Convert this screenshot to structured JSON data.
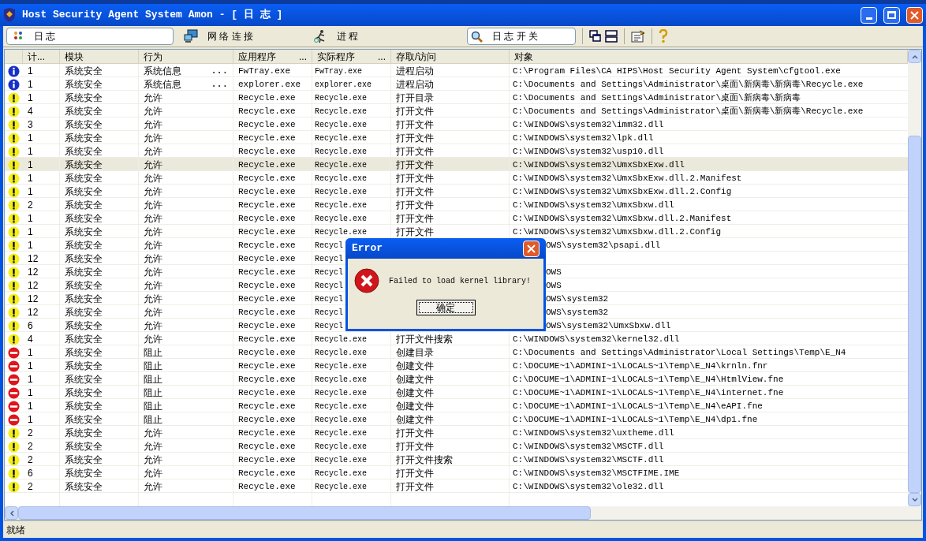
{
  "window": {
    "title": "Host Security Agent System Amon - [ 日 志 ]"
  },
  "toolbar": {
    "buttons": [
      {
        "label": "日 志",
        "kind": "log",
        "selected": true
      },
      {
        "label": "网 络 连 接",
        "kind": "network",
        "selected": false
      },
      {
        "label": "进 程",
        "kind": "process",
        "selected": false
      }
    ],
    "search": {
      "value": "日 志 开 关"
    }
  },
  "table": {
    "columns": [
      {
        "label": "计..."
      },
      {
        "label": "模块"
      },
      {
        "label": "行为"
      },
      {
        "label": "应用程序",
        "more": "..."
      },
      {
        "label": "实际程序",
        "more": "..."
      },
      {
        "label": "存取/访问"
      },
      {
        "label": "对象"
      }
    ],
    "rows": [
      {
        "kind": "info",
        "count": "1",
        "module": "系统安全",
        "action": "系统信息",
        "action_more": "...",
        "app": "FwTray.exe",
        "actual": "FwTray.exe",
        "access": "进程启动",
        "object": "C:\\Program Files\\CA HIPS\\Host Security Agent System\\cfgtool.exe",
        "selected": false
      },
      {
        "kind": "info",
        "count": "1",
        "module": "系统安全",
        "action": "系统信息",
        "action_more": "...",
        "app": "explorer.exe",
        "actual": "explorer.exe",
        "access": "进程启动",
        "object": "C:\\Documents and Settings\\Administrator\\桌面\\新病毒\\新病毒\\Recycle.exe",
        "selected": false
      },
      {
        "kind": "warning",
        "count": "1",
        "module": "系统安全",
        "action": "允许",
        "app": "Recycle.exe",
        "actual": "Recycle.exe",
        "access": "打开目录",
        "object": "C:\\Documents and Settings\\Administrator\\桌面\\新病毒\\新病毒",
        "selected": false
      },
      {
        "kind": "warning",
        "count": "4",
        "module": "系统安全",
        "action": "允许",
        "app": "Recycle.exe",
        "actual": "Recycle.exe",
        "access": "打开文件",
        "object": "C:\\Documents and Settings\\Administrator\\桌面\\新病毒\\新病毒\\Recycle.exe",
        "selected": false
      },
      {
        "kind": "warning",
        "count": "3",
        "module": "系统安全",
        "action": "允许",
        "app": "Recycle.exe",
        "actual": "Recycle.exe",
        "access": "打开文件",
        "object": "C:\\WINDOWS\\system32\\imm32.dll",
        "selected": false
      },
      {
        "kind": "warning",
        "count": "1",
        "module": "系统安全",
        "action": "允许",
        "app": "Recycle.exe",
        "actual": "Recycle.exe",
        "access": "打开文件",
        "object": "C:\\WINDOWS\\system32\\lpk.dll",
        "selected": false
      },
      {
        "kind": "warning",
        "count": "1",
        "module": "系统安全",
        "action": "允许",
        "app": "Recycle.exe",
        "actual": "Recycle.exe",
        "access": "打开文件",
        "object": "C:\\WINDOWS\\system32\\usp10.dll",
        "selected": false
      },
      {
        "kind": "warning",
        "count": "1",
        "module": "系统安全",
        "action": "允许",
        "app": "Recycle.exe",
        "actual": "Recycle.exe",
        "access": "打开文件",
        "object": "C:\\WINDOWS\\system32\\UmxSbxExw.dll",
        "selected": true
      },
      {
        "kind": "warning",
        "count": "1",
        "module": "系统安全",
        "action": "允许",
        "app": "Recycle.exe",
        "actual": "Recycle.exe",
        "access": "打开文件",
        "object": "C:\\WINDOWS\\system32\\UmxSbxExw.dll.2.Manifest",
        "selected": false
      },
      {
        "kind": "warning",
        "count": "1",
        "module": "系统安全",
        "action": "允许",
        "app": "Recycle.exe",
        "actual": "Recycle.exe",
        "access": "打开文件",
        "object": "C:\\WINDOWS\\system32\\UmxSbxExw.dll.2.Config",
        "selected": false
      },
      {
        "kind": "warning",
        "count": "2",
        "module": "系统安全",
        "action": "允许",
        "app": "Recycle.exe",
        "actual": "Recycle.exe",
        "access": "打开文件",
        "object": "C:\\WINDOWS\\system32\\UmxSbxw.dll",
        "selected": false
      },
      {
        "kind": "warning",
        "count": "1",
        "module": "系统安全",
        "action": "允许",
        "app": "Recycle.exe",
        "actual": "Recycle.exe",
        "access": "打开文件",
        "object": "C:\\WINDOWS\\system32\\UmxSbxw.dll.2.Manifest",
        "selected": false
      },
      {
        "kind": "warning",
        "count": "1",
        "module": "系统安全",
        "action": "允许",
        "app": "Recycle.exe",
        "actual": "Recycle.exe",
        "access": "打开文件",
        "object": "C:\\WINDOWS\\system32\\UmxSbxw.dll.2.Config",
        "selected": false
      },
      {
        "kind": "warning",
        "count": "1",
        "module": "系统安全",
        "action": "允许",
        "app": "Recycle.exe",
        "actual": "Recycl",
        "object": "OWS\\system32\\psapi.dll",
        "object_covered": true,
        "selected": false
      },
      {
        "kind": "warning",
        "count": "12",
        "module": "系统安全",
        "action": "允许",
        "app": "Recycle.exe",
        "actual": "Recycl",
        "selected": false
      },
      {
        "kind": "warning",
        "count": "12",
        "module": "系统安全",
        "action": "允许",
        "app": "Recycle.exe",
        "actual": "Recycl",
        "object": "OWS",
        "object_covered": true,
        "selected": false
      },
      {
        "kind": "warning",
        "count": "12",
        "module": "系统安全",
        "action": "允许",
        "app": "Recycle.exe",
        "actual": "Recycl",
        "object": "OWS",
        "object_covered": true,
        "selected": false
      },
      {
        "kind": "warning",
        "count": "12",
        "module": "系统安全",
        "action": "允许",
        "app": "Recycle.exe",
        "actual": "Recycl",
        "object": "OWS\\system32",
        "object_covered": true,
        "selected": false
      },
      {
        "kind": "warning",
        "count": "12",
        "module": "系统安全",
        "action": "允许",
        "app": "Recycle.exe",
        "actual": "Recycl",
        "object": "OWS\\system32",
        "object_covered": true,
        "selected": false
      },
      {
        "kind": "warning",
        "count": "6",
        "module": "系统安全",
        "action": "允许",
        "app": "Recycle.exe",
        "actual": "Recycl",
        "object": "OWS\\system32\\UmxSbxw.dll",
        "object_covered": true,
        "selected": false
      },
      {
        "kind": "warning",
        "count": "4",
        "module": "系统安全",
        "action": "允许",
        "app": "Recycle.exe",
        "actual": "Recycle.exe",
        "access": "打开文件搜索",
        "object": "C:\\WINDOWS\\system32\\kernel32.dll",
        "selected": false
      },
      {
        "kind": "blocked",
        "count": "1",
        "module": "系统安全",
        "action": "阻止",
        "app": "Recycle.exe",
        "actual": "Recycle.exe",
        "access": "创建目录",
        "object": "C:\\Documents and Settings\\Administrator\\Local Settings\\Temp\\E_N4",
        "selected": false
      },
      {
        "kind": "blocked",
        "count": "1",
        "module": "系统安全",
        "action": "阻止",
        "app": "Recycle.exe",
        "actual": "Recycle.exe",
        "access": "创建文件",
        "object": "C:\\DOCUME~1\\ADMINI~1\\LOCALS~1\\Temp\\E_N4\\krnln.fnr",
        "selected": false
      },
      {
        "kind": "blocked",
        "count": "1",
        "module": "系统安全",
        "action": "阻止",
        "app": "Recycle.exe",
        "actual": "Recycle.exe",
        "access": "创建文件",
        "object": "C:\\DOCUME~1\\ADMINI~1\\LOCALS~1\\Temp\\E_N4\\HtmlView.fne",
        "selected": false
      },
      {
        "kind": "blocked",
        "count": "1",
        "module": "系统安全",
        "action": "阻止",
        "app": "Recycle.exe",
        "actual": "Recycle.exe",
        "access": "创建文件",
        "object": "C:\\DOCUME~1\\ADMINI~1\\LOCALS~1\\Temp\\E_N4\\internet.fne",
        "selected": false
      },
      {
        "kind": "blocked",
        "count": "1",
        "module": "系统安全",
        "action": "阻止",
        "app": "Recycle.exe",
        "actual": "Recycle.exe",
        "access": "创建文件",
        "object": "C:\\DOCUME~1\\ADMINI~1\\LOCALS~1\\Temp\\E_N4\\eAPI.fne",
        "selected": false
      },
      {
        "kind": "blocked",
        "count": "1",
        "module": "系统安全",
        "action": "阻止",
        "app": "Recycle.exe",
        "actual": "Recycle.exe",
        "access": "创建文件",
        "object": "C:\\DOCUME~1\\ADMINI~1\\LOCALS~1\\Temp\\E_N4\\dp1.fne",
        "selected": false
      },
      {
        "kind": "warning",
        "count": "2",
        "module": "系统安全",
        "action": "允许",
        "app": "Recycle.exe",
        "actual": "Recycle.exe",
        "access": "打开文件",
        "object": "C:\\WINDOWS\\system32\\uxtheme.dll",
        "selected": false
      },
      {
        "kind": "warning",
        "count": "2",
        "module": "系统安全",
        "action": "允许",
        "app": "Recycle.exe",
        "actual": "Recycle.exe",
        "access": "打开文件",
        "object": "C:\\WINDOWS\\system32\\MSCTF.dll",
        "selected": false
      },
      {
        "kind": "warning",
        "count": "2",
        "module": "系统安全",
        "action": "允许",
        "app": "Recycle.exe",
        "actual": "Recycle.exe",
        "access": "打开文件搜索",
        "object": "C:\\WINDOWS\\system32\\MSCTF.dll",
        "selected": false
      },
      {
        "kind": "warning",
        "count": "6",
        "module": "系统安全",
        "action": "允许",
        "app": "Recycle.exe",
        "actual": "Recycle.exe",
        "access": "打开文件",
        "object": "C:\\WINDOWS\\system32\\MSCTFIME.IME",
        "selected": false
      },
      {
        "kind": "warning",
        "count": "2",
        "module": "系统安全",
        "action": "允许",
        "app": "Recycle.exe",
        "actual": "Recycle.exe",
        "access": "打开文件",
        "object": "C:\\WINDOWS\\system32\\ole32.dll",
        "selected": false
      }
    ]
  },
  "dialog": {
    "title": "Error",
    "message": "Failed to load kernel library!",
    "button": "确定"
  },
  "status_bar": {
    "text": "就绪"
  }
}
